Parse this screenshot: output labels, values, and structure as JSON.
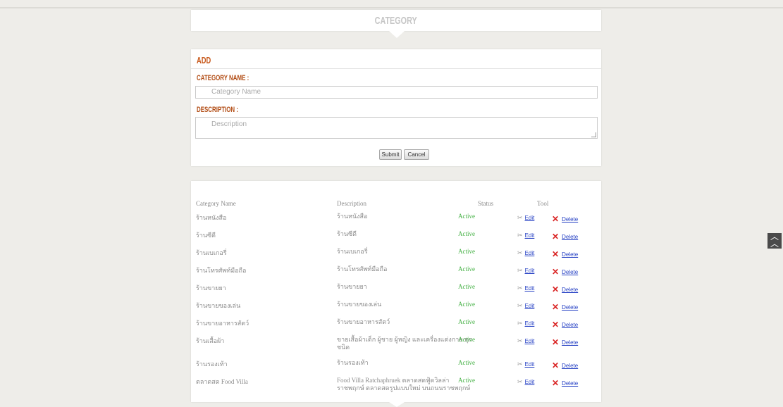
{
  "header": {
    "title": "CATEGORY"
  },
  "form": {
    "heading": "ADD",
    "category_name_label": "CATEGORY NAME :",
    "category_name_placeholder": "Category Name",
    "description_label": "DESCRIPTION :",
    "description_placeholder": "Description",
    "submit_label": "Submit",
    "cancel_label": "Cancel"
  },
  "table": {
    "columns": [
      "Category Name",
      "Description",
      "Status",
      "Tool"
    ],
    "edit_label": "Edit",
    "delete_label": "Delete",
    "rows": [
      {
        "name": "ร้านหนังสือ",
        "description": "ร้านหนังสือ",
        "status": "Active"
      },
      {
        "name": "ร้านซีดี",
        "description": "ร้านซีดี",
        "status": "Active"
      },
      {
        "name": "ร้านเบเกอรี่",
        "description": "ร้านเบเกอรี่",
        "status": "Active"
      },
      {
        "name": "ร้านโทรศัพท์มือถือ",
        "description": "ร้านโทรศัพท์มือถือ",
        "status": "Active"
      },
      {
        "name": "ร้านขายยา",
        "description": "ร้านขายยา",
        "status": "Active"
      },
      {
        "name": "ร้านขายของเล่น",
        "description": "ร้านขายของเล่น",
        "status": "Active"
      },
      {
        "name": "ร้านขายอาหารสัตว์",
        "description": "ร้านขายอาหารสัตว์",
        "status": "Active"
      },
      {
        "name": "ร้านเสื้อผ้า",
        "description": "ขายเสื้อผ้าเด็ก ผู้ชาย ผู้หญิง และเครื่องแต่งกาย ทุกชนิด",
        "status": "Active"
      },
      {
        "name": "ร้านรองเท้า",
        "description": "ร้านรองเท้า",
        "status": "Active"
      },
      {
        "name": "ตลาดสด Food Villa",
        "description": "Food Villa Ratchaphruek ตลาดสดฟู้ดวิลล่า ราชพฤกษ์ ตลาดสดรูปแบบใหม่ บนถนนราชพฤกษ์",
        "status": "Active"
      }
    ]
  },
  "icons": {
    "edit": "scissors-icon",
    "delete": "x-icon",
    "scroll_top": "double-chevron-up-icon"
  },
  "colors": {
    "accent": "#c8581a",
    "status_active": "#43b043",
    "delete": "#d92424",
    "link": "#2540c4"
  }
}
